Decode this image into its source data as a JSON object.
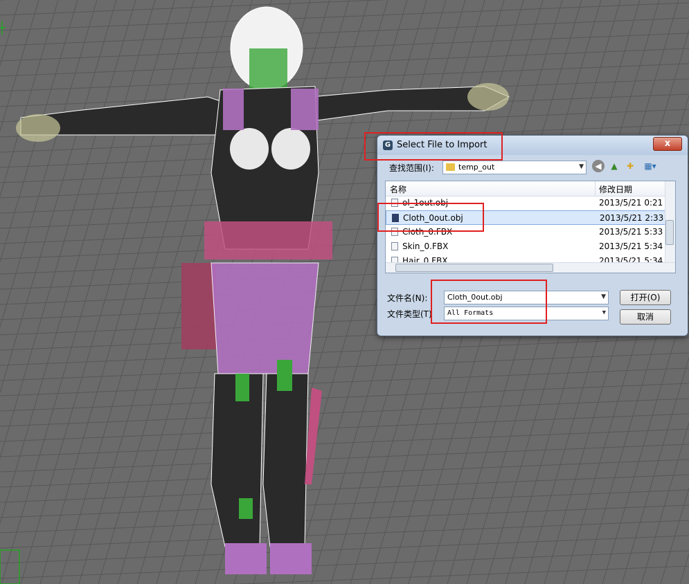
{
  "colors": {
    "viewport_bg": "#6b6b6b",
    "grid_line": "#565656",
    "mesh_wire": "#ffffff",
    "mesh_fill": "#2a2a2a",
    "accent_purple": "#b070c0",
    "accent_green": "#3aa63a",
    "highlight_red": "#e02020",
    "dialog_bg": "#c9d7e8"
  },
  "dialog": {
    "title": "Select File to Import",
    "close_label": "x",
    "app_icon": "G",
    "lookin_label": "查找范围(I):",
    "lookin_value": "temp_out",
    "toolbar_icons": [
      "back-icon",
      "up-folder-icon",
      "new-folder-icon",
      "view-menu-icon"
    ],
    "columns": {
      "name": "名称",
      "modified": "修改日期"
    },
    "files": [
      {
        "name": "ol_1out.obj",
        "date": "2013/5/21 0:21"
      },
      {
        "name": "Cloth_0out.obj",
        "date": "2013/5/21 2:33",
        "selected": true
      },
      {
        "name": "Cloth_0.FBX",
        "date": "2013/5/21 5:33"
      },
      {
        "name": "Skin_0.FBX",
        "date": "2013/5/21 5:34"
      },
      {
        "name": "Hair_0.FBX",
        "date": "2013/5/21 5:34"
      }
    ],
    "filename_label": "文件名(N):",
    "filename_value": "Cloth_0out.obj",
    "filetype_label": "文件类型(T)",
    "filetype_value": "All Formats",
    "open_button": "打开(O)",
    "cancel_button": "取消"
  }
}
